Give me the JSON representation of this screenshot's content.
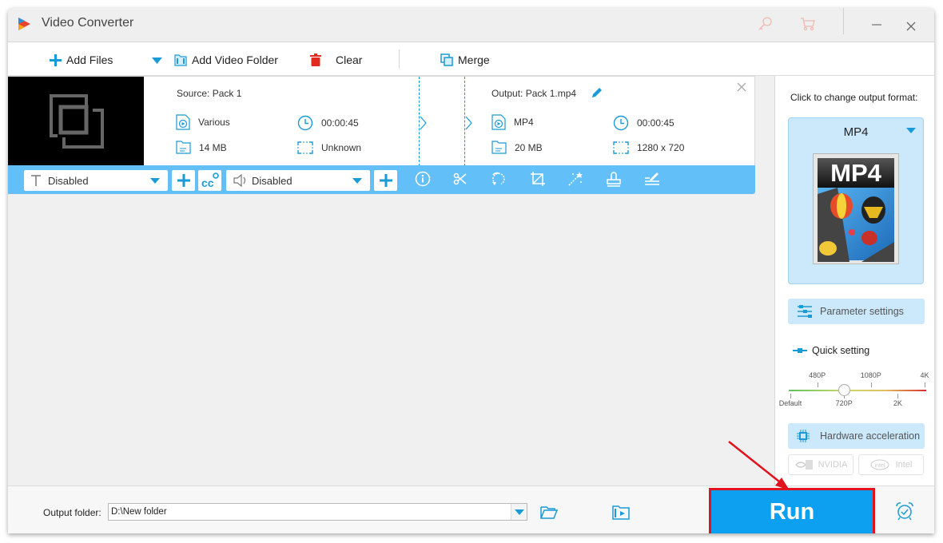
{
  "window": {
    "title": "Video Converter",
    "icons": {
      "register": "key-icon",
      "buy": "cart-icon",
      "minimize": "minimize-icon",
      "close": "close-icon"
    }
  },
  "toolbar": {
    "add_files": "Add Files",
    "add_video_folder": "Add Video Folder",
    "clear": "Clear",
    "merge": "Merge"
  },
  "file": {
    "source_title": "Source: Pack 1",
    "source": {
      "format": "Various",
      "duration": "00:00:45",
      "size": "14 MB",
      "resolution": "Unknown"
    },
    "output_title": "Output: Pack 1.mp4",
    "output": {
      "format": "MP4",
      "duration": "00:00:45",
      "size": "20 MB",
      "resolution": "1280 x 720"
    }
  },
  "edit_bar": {
    "subtitle_select": "Disabled",
    "audio_select": "Disabled",
    "tools": [
      "info-icon",
      "scissors-icon",
      "rotate-icon",
      "crop-icon",
      "effects-wand-icon",
      "watermark-stamp-icon",
      "edit-metadata-icon"
    ]
  },
  "right_panel": {
    "format_prompt": "Click to change output format:",
    "format_name": "MP4",
    "format_thumb_label": "MP4",
    "parameter_settings": "Parameter settings",
    "quick_setting": "Quick setting",
    "quality_levels_top": [
      "480P",
      "1080P",
      "4K"
    ],
    "quality_levels_bottom": [
      "Default",
      "720P",
      "2K"
    ],
    "quality_selected": "720P",
    "hardware_acceleration": "Hardware acceleration",
    "vendors": [
      "NVIDIA",
      "Intel"
    ]
  },
  "bottom": {
    "output_folder_label": "Output folder:",
    "output_folder_value": "D:\\New folder",
    "run": "Run"
  },
  "colors": {
    "accent": "#1a9ad6",
    "edit_bar": "#62bff7",
    "run_button": "#0ea0f0",
    "highlight": "#e0141e"
  }
}
